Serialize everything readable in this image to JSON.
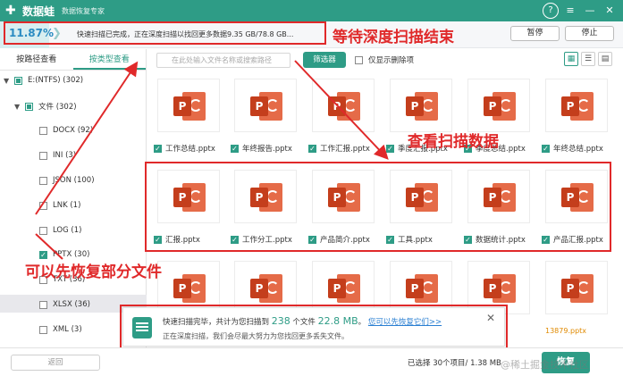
{
  "titlebar": {
    "logo_mark": "✚",
    "app_name": "数据蛙",
    "subtitle": "数据恢复专家",
    "help_glyph": "?",
    "menu_glyph": "≡",
    "min_glyph": "—",
    "close_glyph": "✕"
  },
  "scan": {
    "progress_text": "11.87%",
    "progress_fraction": 0.0787,
    "arrow_glyph": "❯",
    "status_text": "快速扫描已完成，正在深度扫描以找回更多数据9.35 GB/78.8 GB...",
    "pause_label": "暂停",
    "stop_label": "停止"
  },
  "annotations": {
    "wait_deep_scan": "等待深度扫描结束",
    "view_scan_data": "查看扫描数据",
    "recover_partial": "可以先恢复部分文件",
    "color": "#e0292a"
  },
  "leftpane": {
    "tab_path": "按路径查看",
    "tab_type": "按类型查看",
    "tree": [
      {
        "label": "E:(NTFS) (302)",
        "state": "part",
        "caret": "▼"
      },
      {
        "label": "文件 (302)",
        "state": "part",
        "caret": "▼"
      },
      {
        "label": "DOCX (92)",
        "state": "off"
      },
      {
        "label": "INI (3)",
        "state": "off"
      },
      {
        "label": "JSON (100)",
        "state": "off"
      },
      {
        "label": "LNK (1)",
        "state": "off"
      },
      {
        "label": "LOG (1)",
        "state": "off"
      },
      {
        "label": "PPTX (30)",
        "state": "on"
      },
      {
        "label": "TXT (36)",
        "state": "off"
      },
      {
        "label": "XLSX (36)",
        "state": "off"
      },
      {
        "label": "XML (3)",
        "state": "off"
      }
    ]
  },
  "toolbar": {
    "search_placeholder": "在此处输入文件名称或搜索路径",
    "search_glyph": "⌕",
    "filter_label": "筛选器",
    "show_deleted_label": "仅显示删除项",
    "view_grid": "▦",
    "view_list": "☰",
    "view_detail": "▤"
  },
  "files": {
    "badge_letter": "P",
    "check_glyph": "✓",
    "row1": [
      "工作总结.pptx",
      "年终报告.pptx",
      "工作汇报.pptx",
      "季度汇报.pptx",
      "季度总结.pptx",
      "年终总结.pptx"
    ],
    "row2": [
      "汇报.pptx",
      "工作分工.pptx",
      "产品简介.pptx",
      "工具.pptx",
      "数据统计.pptx",
      "产品汇报.pptx"
    ],
    "partial_name": "13879.pptx"
  },
  "toast": {
    "line1_prefix": "快速扫描完毕，共计为您扫描到",
    "count": "238",
    "line1_mid": "个文件",
    "size": "22.8 MB",
    "line1_suffix": "。",
    "link": "您可以先恢复它们>>",
    "line2": "正在深度扫描，我们会尽最大努力为您找回更多丢失文件。",
    "close_glyph": "✕"
  },
  "footer": {
    "back_label": "返回",
    "selection_info": "已选择 30个项目/ 1.38 MB",
    "recover_label": "恢复"
  },
  "watermark": "@稀土掘金技术社区",
  "colors": {
    "brand": "#2e9c86",
    "accent_blue": "#2a8cc2",
    "ppt_orange": "#e56b48",
    "ppt_red": "#c43e1c"
  }
}
